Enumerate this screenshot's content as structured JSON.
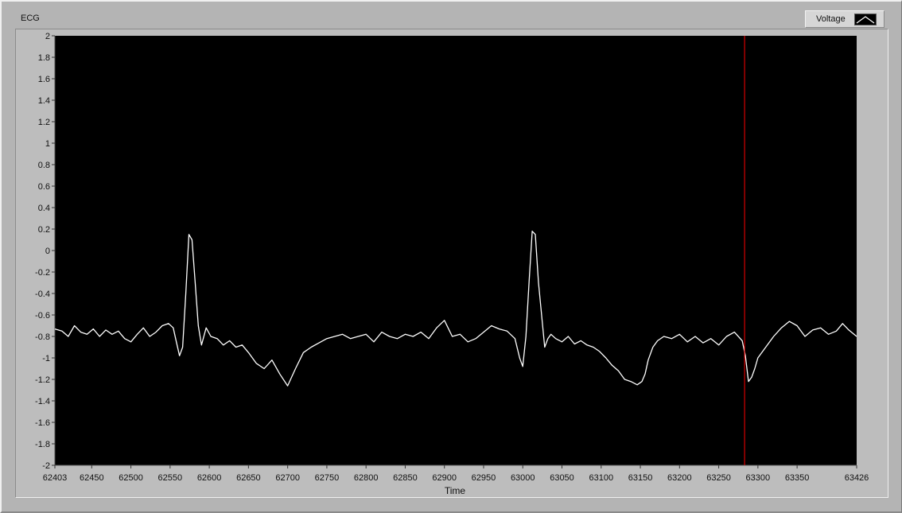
{
  "chart_data": {
    "type": "line",
    "title": "ECG",
    "xlabel": "Time",
    "ylabel": "",
    "xlim": [
      62403,
      63426
    ],
    "ylim": [
      -2,
      2
    ],
    "x_ticks": [
      "62403",
      "62450",
      "62500",
      "62550",
      "62600",
      "62650",
      "62700",
      "62750",
      "62800",
      "62850",
      "62900",
      "62950",
      "63000",
      "63050",
      "63100",
      "63150",
      "63200",
      "63250",
      "63300",
      "63350",
      "63426"
    ],
    "y_ticks": [
      "2",
      "1.8",
      "1.6",
      "1.4",
      "1.2",
      "1",
      "0.8",
      "0.6",
      "0.4",
      "0.2",
      "0",
      "-0.2",
      "-0.4",
      "-0.6",
      "-0.8",
      "-1",
      "-1.2",
      "-1.4",
      "-1.6",
      "-1.8",
      "-2"
    ],
    "grid": false,
    "legend_position": "top-right",
    "cursor_x": 63283,
    "background_color": "#000000",
    "line_color": "#ffffff",
    "cursor_color": "#ff0000",
    "series": [
      {
        "name": "Voltage",
        "x": [
          62403,
          62412,
          62420,
          62428,
          62436,
          62444,
          62452,
          62460,
          62468,
          62476,
          62484,
          62492,
          62500,
          62508,
          62516,
          62524,
          62532,
          62540,
          62548,
          62554,
          62558,
          62562,
          62566,
          62570,
          62574,
          62578,
          62582,
          62586,
          62590,
          62596,
          62602,
          62610,
          62618,
          62626,
          62634,
          62642,
          62650,
          62660,
          62670,
          62680,
          62690,
          62700,
          62710,
          62720,
          62730,
          62740,
          62750,
          62760,
          62770,
          62780,
          62790,
          62800,
          62810,
          62820,
          62830,
          62840,
          62850,
          62860,
          62870,
          62880,
          62890,
          62900,
          62910,
          62920,
          62930,
          62940,
          62950,
          62960,
          62970,
          62980,
          62990,
          62996,
          63000,
          63004,
          63008,
          63012,
          63016,
          63020,
          63024,
          63028,
          63032,
          63036,
          63042,
          63050,
          63058,
          63066,
          63074,
          63082,
          63090,
          63098,
          63106,
          63114,
          63122,
          63130,
          63138,
          63146,
          63152,
          63156,
          63160,
          63166,
          63172,
          63180,
          63190,
          63200,
          63210,
          63220,
          63230,
          63240,
          63250,
          63260,
          63270,
          63280,
          63284,
          63288,
          63292,
          63296,
          63300,
          63310,
          63320,
          63330,
          63340,
          63350,
          63360,
          63370,
          63380,
          63390,
          63400,
          63408,
          63416,
          63426
        ],
        "y": [
          -0.73,
          -0.75,
          -0.8,
          -0.7,
          -0.76,
          -0.78,
          -0.73,
          -0.8,
          -0.74,
          -0.78,
          -0.75,
          -0.82,
          -0.85,
          -0.78,
          -0.72,
          -0.8,
          -0.76,
          -0.7,
          -0.68,
          -0.72,
          -0.85,
          -0.98,
          -0.9,
          -0.4,
          0.15,
          0.1,
          -0.3,
          -0.7,
          -0.88,
          -0.72,
          -0.8,
          -0.82,
          -0.88,
          -0.84,
          -0.9,
          -0.88,
          -0.95,
          -1.05,
          -1.1,
          -1.02,
          -1.15,
          -1.26,
          -1.1,
          -0.95,
          -0.9,
          -0.86,
          -0.82,
          -0.8,
          -0.78,
          -0.82,
          -0.8,
          -0.78,
          -0.85,
          -0.76,
          -0.8,
          -0.82,
          -0.78,
          -0.8,
          -0.76,
          -0.82,
          -0.72,
          -0.65,
          -0.8,
          -0.78,
          -0.85,
          -0.82,
          -0.76,
          -0.7,
          -0.73,
          -0.75,
          -0.82,
          -1.0,
          -1.08,
          -0.8,
          -0.3,
          0.18,
          0.15,
          -0.3,
          -0.6,
          -0.9,
          -0.82,
          -0.78,
          -0.82,
          -0.85,
          -0.8,
          -0.87,
          -0.84,
          -0.88,
          -0.9,
          -0.94,
          -1.0,
          -1.07,
          -1.12,
          -1.2,
          -1.22,
          -1.25,
          -1.22,
          -1.15,
          -1.02,
          -0.9,
          -0.84,
          -0.8,
          -0.82,
          -0.78,
          -0.85,
          -0.8,
          -0.86,
          -0.82,
          -0.88,
          -0.8,
          -0.76,
          -0.84,
          -0.98,
          -1.22,
          -1.18,
          -1.1,
          -1.0,
          -0.9,
          -0.8,
          -0.72,
          -0.66,
          -0.7,
          -0.8,
          -0.74,
          -0.72,
          -0.78,
          -0.75,
          -0.68,
          -0.74,
          -0.8
        ]
      }
    ]
  }
}
